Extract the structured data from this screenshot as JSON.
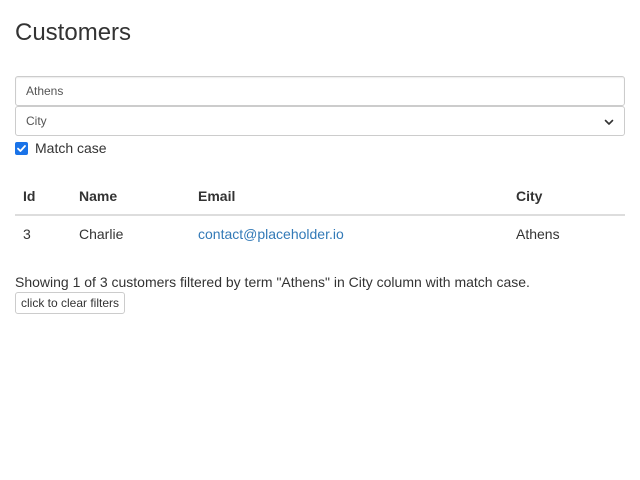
{
  "page": {
    "title": "Customers"
  },
  "filters": {
    "search_value": "Athens",
    "column_select_value": "City",
    "match_case_label": "Match case",
    "match_case_checked": true
  },
  "table": {
    "headers": [
      "Id",
      "Name",
      "Email",
      "City"
    ],
    "rows": [
      {
        "id": "3",
        "name": "Charlie",
        "email": "contact@placeholder.io",
        "city": "Athens"
      }
    ]
  },
  "status": {
    "text": "Showing 1 of 3 customers filtered by term \"Athens\" in City column with match case.",
    "clear_button_label": "click to clear filters"
  },
  "colors": {
    "accent": "#1a73e8",
    "link": "#337ab7"
  }
}
